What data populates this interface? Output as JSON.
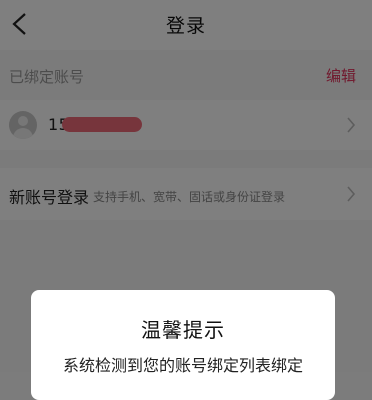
{
  "header": {
    "title": "登录",
    "back_icon": "chevron-left-icon"
  },
  "bound_accounts": {
    "label": "已绑定账号",
    "edit_label": "编辑",
    "accent_color": "#e2335c",
    "items": [
      {
        "phone": "155",
        "redacted": true
      }
    ]
  },
  "new_account": {
    "label": "新账号登录",
    "hint": "支持手机、宽带、固话或身份证登录"
  },
  "dialog": {
    "title": "温馨提示",
    "message": "系统检测到您的账号绑定列表绑定"
  }
}
